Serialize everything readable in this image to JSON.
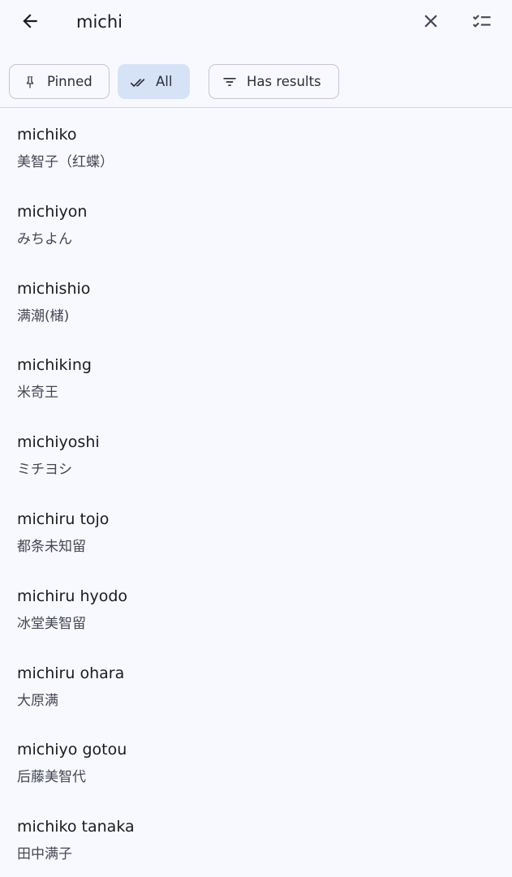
{
  "search": {
    "value": "michi"
  },
  "icons": {
    "back": "arrow-left-icon",
    "clear": "close-icon",
    "select": "checklist-icon",
    "pinned": "pin-icon",
    "all": "double-check-icon",
    "has_results": "filter-icon"
  },
  "filters": {
    "pinned": "Pinned",
    "all": "All",
    "has_results": "Has results"
  },
  "colors": {
    "background": "#f8f9ff",
    "chip_selected": "#d6e3f7",
    "text": "#1b1b1f",
    "subtext": "#44474f"
  },
  "results": [
    {
      "title": "michiko",
      "subtitle": "美智子（红蝶）"
    },
    {
      "title": "michiyon",
      "subtitle": "みちよん"
    },
    {
      "title": "michishio",
      "subtitle": "满潮(槠)"
    },
    {
      "title": "michiking",
      "subtitle": "米奇王"
    },
    {
      "title": "michiyoshi",
      "subtitle": "ミチヨシ"
    },
    {
      "title": "michiru tojo",
      "subtitle": "都条未知留"
    },
    {
      "title": "michiru hyodo",
      "subtitle": "冰堂美智留"
    },
    {
      "title": "michiru ohara",
      "subtitle": "大原满"
    },
    {
      "title": "michiyo gotou",
      "subtitle": "后藤美智代"
    },
    {
      "title": "michiko tanaka",
      "subtitle": "田中满子"
    }
  ]
}
